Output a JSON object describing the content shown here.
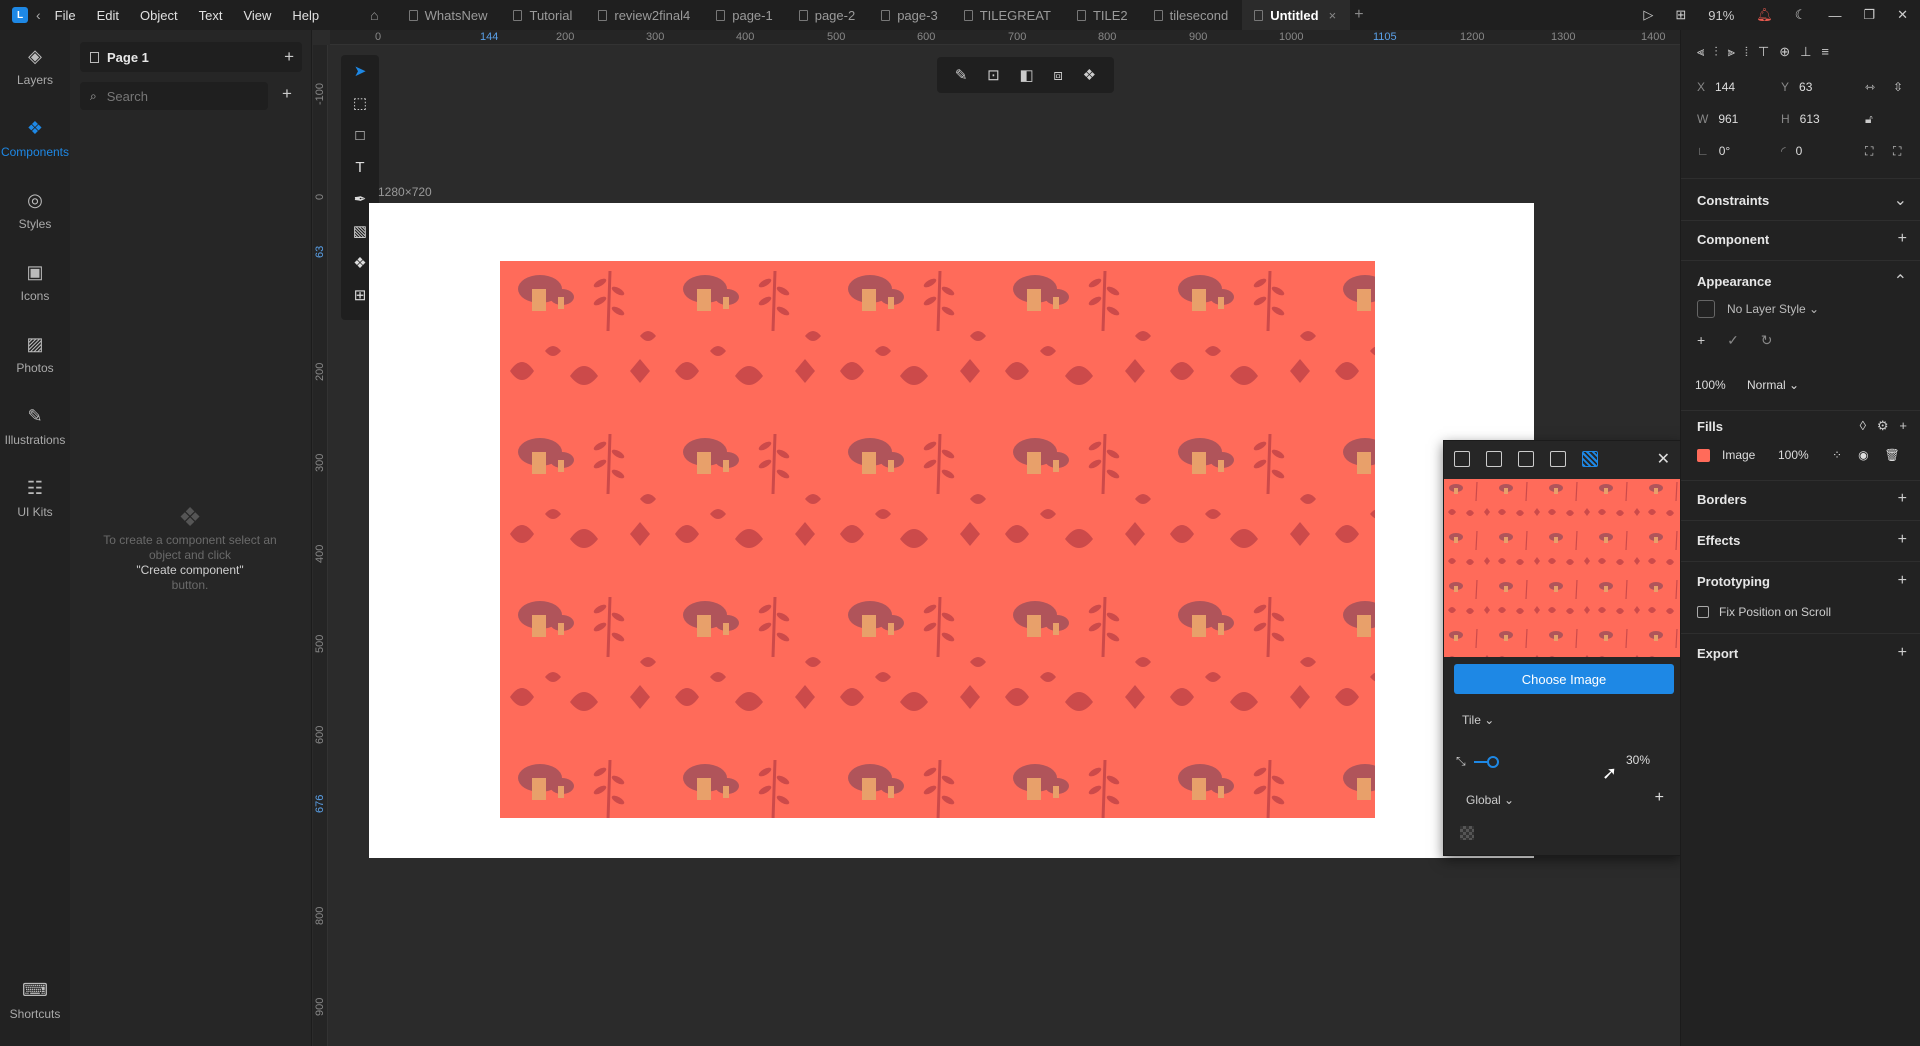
{
  "titlebar": {
    "menu": [
      "File",
      "Edit",
      "Object",
      "Text",
      "View",
      "Help"
    ],
    "tabs": [
      "WhatsNew",
      "Tutorial",
      "review2final4",
      "page-1",
      "page-2",
      "page-3",
      "TILEGREAT",
      "TILE2",
      "tilesecond",
      "Untitled"
    ],
    "active_tab": "Untitled",
    "zoom": "91%"
  },
  "leftnav": {
    "items": [
      {
        "label": "Layers",
        "icon": "layers-icon"
      },
      {
        "label": "Components",
        "icon": "components-icon"
      },
      {
        "label": "Styles",
        "icon": "styles-icon"
      },
      {
        "label": "Icons",
        "icon": "icons-icon"
      },
      {
        "label": "Photos",
        "icon": "photos-icon"
      },
      {
        "label": "Illustrations",
        "icon": "illustrations-icon"
      },
      {
        "label": "UI Kits",
        "icon": "ui-kits-icon"
      }
    ],
    "shortcuts": "Shortcuts"
  },
  "leftpanel": {
    "page_name": "Page 1",
    "search_placeholder": "Search",
    "empty_line1": "To create a component select an object and click",
    "empty_quote": "\"Create component\"",
    "empty_line2": "button."
  },
  "rulers": {
    "top": [
      "0",
      "144",
      "200",
      "300",
      "400",
      "500",
      "600",
      "700",
      "800",
      "900",
      "1000",
      "1105",
      "1200",
      "1300",
      "1400"
    ],
    "left": [
      "-100",
      "0",
      "63",
      "200",
      "300",
      "400",
      "500",
      "600",
      "676",
      "800",
      "900"
    ]
  },
  "canvas": {
    "artboard_label": "1280×720",
    "pattern_color": "#ff6b5a"
  },
  "image_popup": {
    "choose_label": "Choose Image",
    "mode_label": "Tile",
    "scale_value": "30%",
    "scope_label": "Global"
  },
  "inspector": {
    "x_label": "X",
    "x": "144",
    "y_label": "Y",
    "y": "63",
    "w_label": "W",
    "w": "961",
    "h_label": "H",
    "h": "613",
    "rotation": "0°",
    "radius": "0",
    "sections": {
      "constraints": "Constraints",
      "component": "Component",
      "appearance": "Appearance",
      "fills": "Fills",
      "borders": "Borders",
      "effects": "Effects",
      "prototyping": "Prototyping",
      "export": "Export"
    },
    "layer_style": "No Layer Style",
    "opacity": "100%",
    "blend": "Normal",
    "fill_type": "Image",
    "fill_opacity": "100%",
    "fix_position": "Fix Position on Scroll"
  }
}
